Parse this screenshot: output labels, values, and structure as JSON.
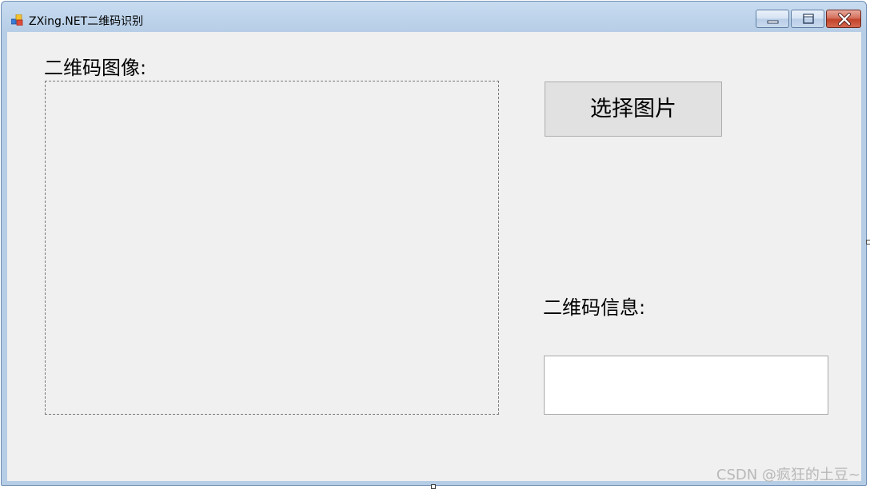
{
  "window": {
    "title": "ZXing.NET二维码识别",
    "icon": "winforms-app-icon",
    "controls": {
      "minimize": "minimize-icon",
      "maximize": "maximize-icon",
      "close": "close-icon"
    }
  },
  "form": {
    "image_label": "二维码图像:",
    "select_button_label": "选择图片",
    "info_label": "二维码信息:",
    "info_value": ""
  },
  "watermark": "CSDN @疯狂的土豆~",
  "colors": {
    "client_bg": "#f0f0f0",
    "button_bg": "#e1e1e1",
    "close_button": "#c2432b"
  }
}
